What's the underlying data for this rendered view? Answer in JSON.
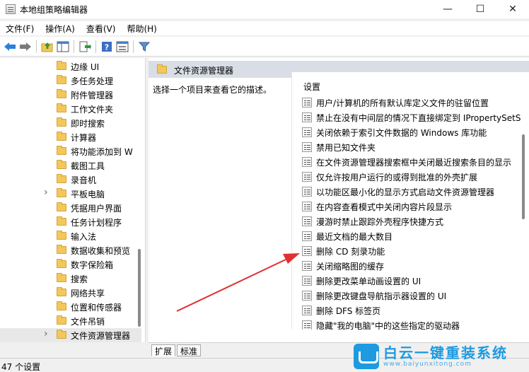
{
  "window": {
    "title": "本地组策略编辑器",
    "minimize": "—",
    "maximize": "☐",
    "close": "✕"
  },
  "menu": [
    "文件(F)",
    "操作(A)",
    "查看(V)",
    "帮助(H)"
  ],
  "toolbar_icons": [
    "back-arrow-icon",
    "forward-arrow-icon",
    "up-folder-icon",
    "show-hide-tree-icon",
    "export-list-icon",
    "help-icon",
    "properties-icon",
    "filter-icon"
  ],
  "tree": {
    "items": [
      {
        "label": "边缘 UI",
        "expander": false
      },
      {
        "label": "多任务处理",
        "expander": false
      },
      {
        "label": "附件管理器",
        "expander": false
      },
      {
        "label": "工作文件夹",
        "expander": false
      },
      {
        "label": "即时搜索",
        "expander": false
      },
      {
        "label": "计算器",
        "expander": false
      },
      {
        "label": "将功能添加到 W",
        "expander": false
      },
      {
        "label": "截图工具",
        "expander": false
      },
      {
        "label": "录音机",
        "expander": false
      },
      {
        "label": "平板电脑",
        "expander": true
      },
      {
        "label": "凭据用户界面",
        "expander": false
      },
      {
        "label": "任务计划程序",
        "expander": false
      },
      {
        "label": "输入法",
        "expander": false
      },
      {
        "label": "数据收集和预览",
        "expander": false
      },
      {
        "label": "数字保险箱",
        "expander": false
      },
      {
        "label": "搜索",
        "expander": false
      },
      {
        "label": "网络共享",
        "expander": false
      },
      {
        "label": "位置和传感器",
        "expander": false
      },
      {
        "label": "文件吊销",
        "expander": false
      },
      {
        "label": "文件资源管理器",
        "expander": true,
        "selected": true
      }
    ]
  },
  "right": {
    "header": "文件资源管理器",
    "description": "选择一个项目来查看它的描述。",
    "settings_header": "设置",
    "settings": [
      "用户/计算机的所有默认库定义文件的驻留位置",
      "禁止在没有中间层的情况下直接绑定到 IPropertySetS",
      "关闭依赖于索引文件数据的 Windows 库功能",
      "禁用已知文件夹",
      "在文件资源管理器搜索框中关闭最近搜索条目的显示",
      "仅允许按用户运行的或得到批准的外壳扩展",
      "以功能区最小化的显示方式启动文件资源管理器",
      "在内容查看模式中关闭内容片段显示",
      "漫游时禁止跟踪外壳程序快捷方式",
      "最近文档的最大数目",
      "删除 CD 刻录功能",
      "关闭缩略图的缓存",
      "删除更改菜单动画设置的 UI",
      "删除更改键盘导航指示器设置的 UI",
      "删除 DFS 标签页",
      "隐藏\"我的电脑\"中的这些指定的驱动器"
    ]
  },
  "tabs": [
    "扩展",
    "标准"
  ],
  "status": "47 个设置",
  "watermark": {
    "title": "白云一键重装系统",
    "url": "www.baiyunxitong.com"
  },
  "colors": {
    "arrow": "#e03030",
    "accent": "#1e9ae0",
    "folder": "#f3c75a"
  }
}
